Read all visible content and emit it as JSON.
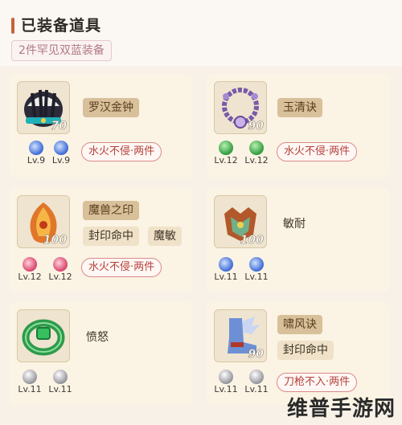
{
  "header": {
    "title": "已装备道具",
    "set_badge": "2件罕见双蓝装备"
  },
  "colors": {
    "accent": "#c8623a",
    "card_bg": "#fbf3e3",
    "set_tag_red": "#b3403a"
  },
  "cards": [
    {
      "icon": "striped-helmet-icon",
      "item_level": "70",
      "name": "罗汉金钟",
      "attrs": [],
      "set_tag": "水火不侵·两件",
      "gems": [
        {
          "icon": "moon-gem-icon",
          "level": "Lv.9"
        },
        {
          "icon": "moon-gem-icon",
          "level": "Lv.9"
        }
      ]
    },
    {
      "icon": "bead-necklace-icon",
      "item_level": "90",
      "name": "玉清诀",
      "attrs": [],
      "set_tag": "水火不侵·两件",
      "gems": [
        {
          "icon": "green-gem-icon",
          "level": "Lv.12"
        },
        {
          "icon": "green-gem-icon",
          "level": "Lv.12"
        }
      ]
    },
    {
      "icon": "fire-leaf-armor-icon",
      "item_level": "100",
      "name": "魔兽之印",
      "attrs": [
        "封印命中",
        "魔敏"
      ],
      "set_tag": "水火不侵·两件",
      "gems": [
        {
          "icon": "red-gem-icon",
          "level": "Lv.12"
        },
        {
          "icon": "red-gem-icon",
          "level": "Lv.12"
        }
      ]
    },
    {
      "icon": "beast-armor-icon",
      "item_level": "100",
      "name": "",
      "attrs": [
        "敏耐"
      ],
      "set_tag": "",
      "gems": [
        {
          "icon": "moon-gem-icon",
          "level": "Lv.11"
        },
        {
          "icon": "moon-gem-icon",
          "level": "Lv.11"
        }
      ]
    },
    {
      "icon": "jade-bracelet-icon",
      "item_level": "",
      "name": "",
      "attrs": [
        "愤怒"
      ],
      "set_tag": "",
      "gems": [
        {
          "icon": "white-gem-icon",
          "level": "Lv.11"
        },
        {
          "icon": "white-gem-icon",
          "level": "Lv.11"
        }
      ]
    },
    {
      "icon": "winged-boots-icon",
      "item_level": "90",
      "name": "啸风诀",
      "attrs": [
        "封印命中"
      ],
      "set_tag": "刀枪不入·两件",
      "gems": [
        {
          "icon": "white-gem-icon",
          "level": "Lv.11"
        },
        {
          "icon": "white-gem-icon",
          "level": "Lv.11"
        }
      ]
    }
  ],
  "watermark": "维普手游网"
}
